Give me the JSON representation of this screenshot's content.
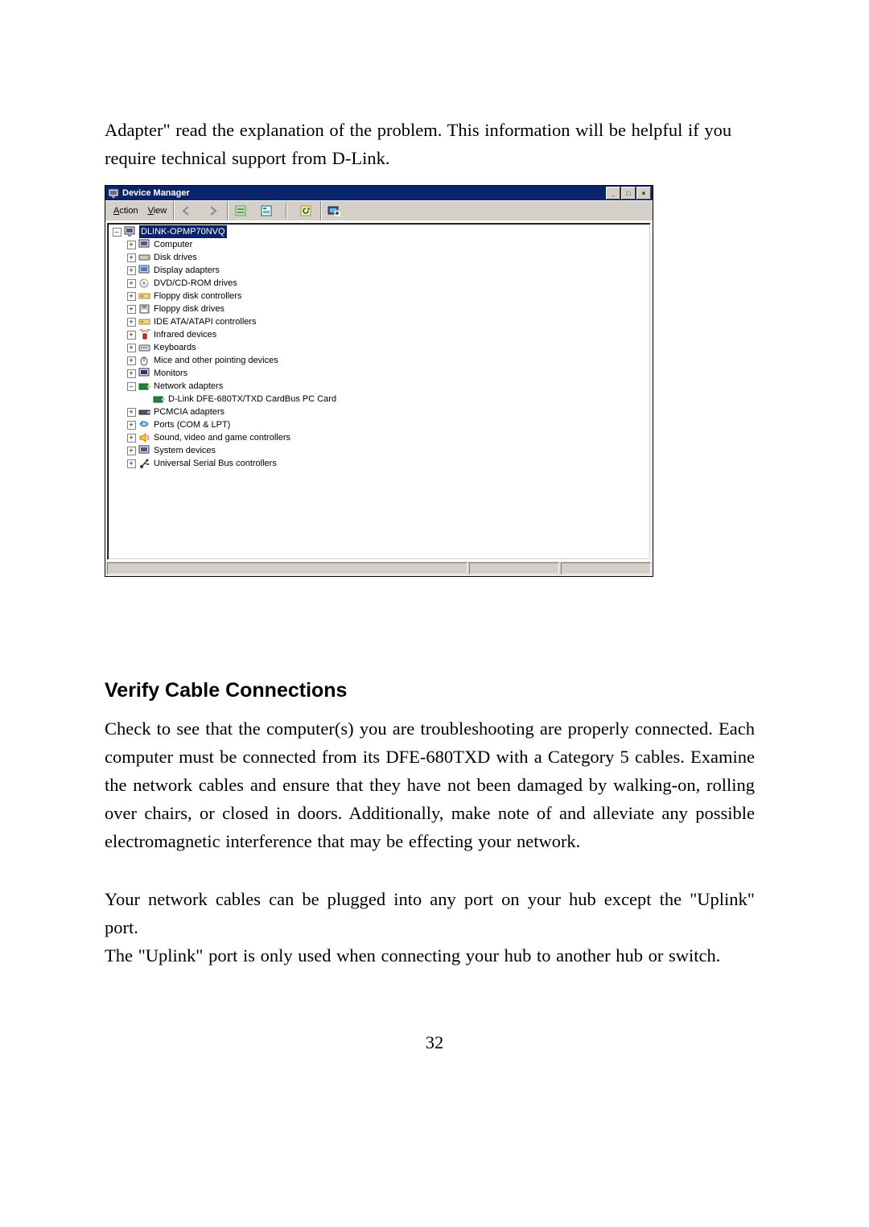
{
  "top_paragraph_l1": "Adapter\" read the explanation of the problem. This information will be helpful if you",
  "top_paragraph_l2": "require technical support  from D-Link.",
  "window": {
    "title": "Device Manager",
    "menu_action": "Action",
    "menu_view": "View",
    "min": "_",
    "max": "□",
    "close": "×"
  },
  "tree": {
    "root": "DLINK-OPMP70NVQ",
    "n1": "Computer",
    "n2": "Disk drives",
    "n3": "Display adapters",
    "n4": "DVD/CD-ROM drives",
    "n5": "Floppy disk controllers",
    "n6": "Floppy disk drives",
    "n7": "IDE ATA/ATAPI controllers",
    "n8": "Infrared devices",
    "n9": "Keyboards",
    "n10": "Mice and other pointing devices",
    "n11": "Monitors",
    "n12": "Network adapters",
    "n12a": "D-Link DFE-680TX/TXD CardBus PC Card",
    "n13": "PCMCIA adapters",
    "n14": "Ports (COM & LPT)",
    "n15": "Sound, video and game controllers",
    "n16": "System devices",
    "n17": "Universal Serial Bus controllers"
  },
  "heading": "Verify Cable Connections",
  "p2": "Check to see that the computer(s) you are troubleshooting are properly connected. Each computer must be connected from its DFE-680TXD with a Category 5 cables. Examine the network cables and ensure that they have not been damaged by walking-on, rolling over chairs, or closed in doors. Additionally, make note of and alleviate any possible electromagnetic interference that may be effecting your network.",
  "p3_l1": "Your network cables can be plugged into any port on your hub except the \"Uplink\" port.",
  "p3_l2": "The \"Uplink\" port is only used when connecting your hub to another hub or switch.",
  "pagenum": "32"
}
